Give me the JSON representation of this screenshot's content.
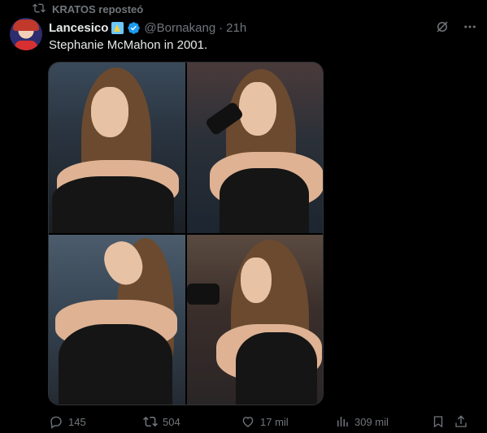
{
  "repost": {
    "label": "KRATOS reposteó",
    "icon": "repost-icon"
  },
  "tweet": {
    "display_name": "Lancesico",
    "handle": "@Bornakang",
    "separator": "·",
    "time": "21h",
    "text": "Stephanie McMahon in 2001.",
    "verified_color": "#1d9bf0"
  },
  "actions": {
    "replies": "145",
    "reposts": "504",
    "likes": "17 mil",
    "views": "309 mil"
  },
  "colors": {
    "background": "#000000",
    "text": "#e7e9ea",
    "muted": "#71767b"
  }
}
